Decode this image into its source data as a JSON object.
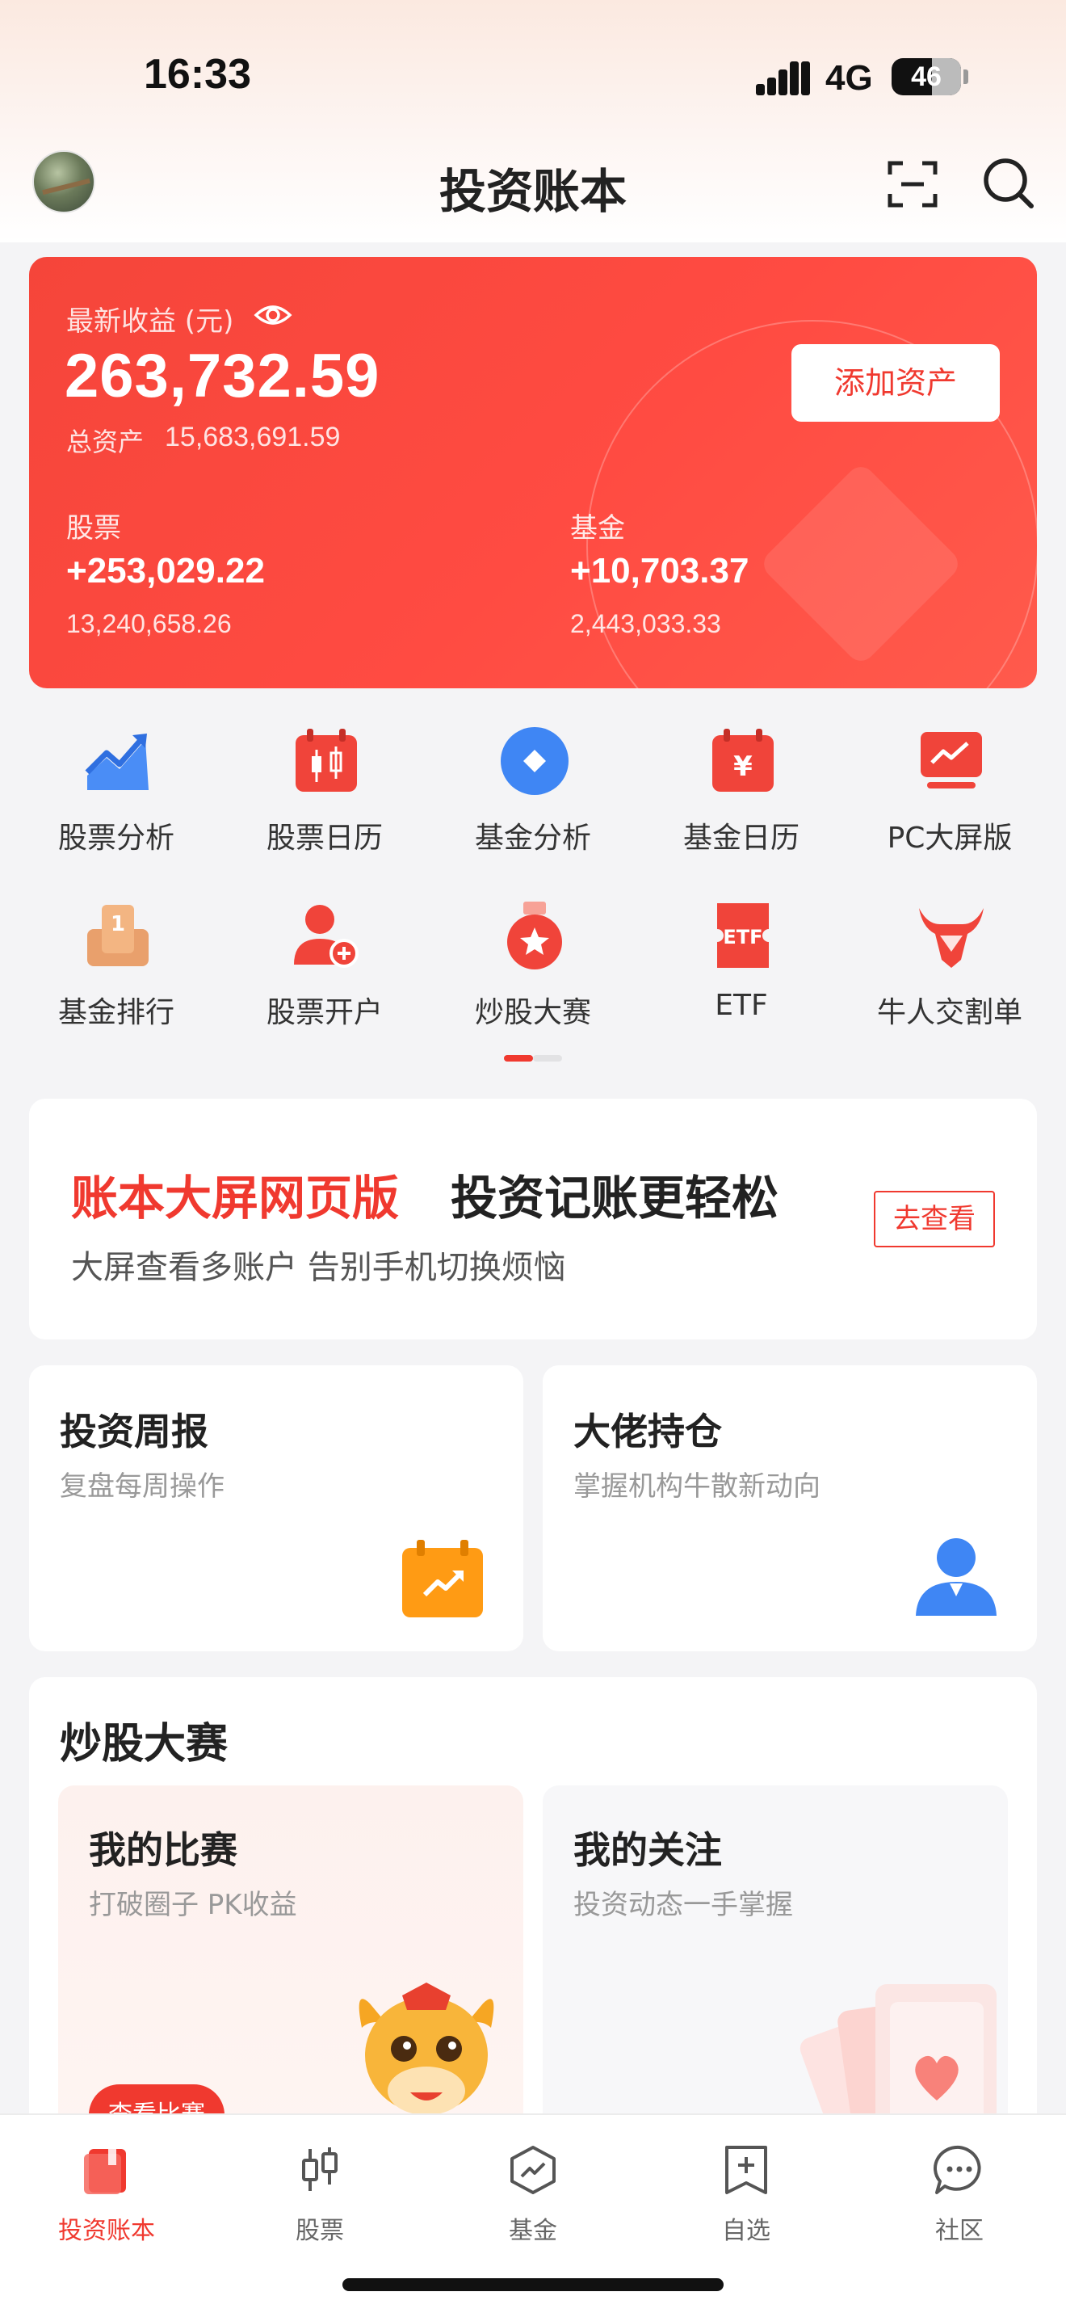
{
  "status_bar": {
    "time": "16:33",
    "network": "4G",
    "battery": "46"
  },
  "nav": {
    "title": "投资账本"
  },
  "summary": {
    "latest_label": "最新收益 (元)",
    "latest_value": "263,732.59",
    "total_label": "总资产",
    "total_value": "15,683,691.59",
    "add_button": "添加资产",
    "stock": {
      "label": "股票",
      "profit": "+253,029.22",
      "total": "13,240,658.26"
    },
    "fund": {
      "label": "基金",
      "profit": "+10,703.37",
      "total": "2,443,033.33"
    }
  },
  "shortcuts": [
    {
      "label": "股票分析",
      "icon": "trend-chart-icon"
    },
    {
      "label": "股票日历",
      "icon": "candlestick-calendar-icon"
    },
    {
      "label": "基金分析",
      "icon": "diamond-circle-icon"
    },
    {
      "label": "基金日历",
      "icon": "yen-calendar-icon"
    },
    {
      "label": "PC大屏版",
      "icon": "monitor-icon"
    },
    {
      "label": "基金排行",
      "icon": "podium-icon"
    },
    {
      "label": "股票开户",
      "icon": "add-user-icon"
    },
    {
      "label": "炒股大赛",
      "icon": "medal-icon"
    },
    {
      "label": "ETF",
      "icon": "etf-ticket-icon"
    },
    {
      "label": "牛人交割单",
      "icon": "bull-icon"
    }
  ],
  "banner": {
    "highlight": "账本大屏网页版",
    "title": "投资记账更轻松",
    "subtitle": "大屏查看多账户 告别手机切换烦恼",
    "button": "去查看"
  },
  "cards": {
    "weekly": {
      "title": "投资周报",
      "subtitle": "复盘每周操作"
    },
    "holdings": {
      "title": "大佬持仓",
      "subtitle": "掌握机构牛散新动向"
    }
  },
  "contest": {
    "heading": "炒股大赛",
    "mine": {
      "title": "我的比赛",
      "subtitle": "打破圈子 PK收益",
      "button": "查看比赛"
    },
    "follow": {
      "title": "我的关注",
      "subtitle": "投资动态一手掌握"
    }
  },
  "tabbar": [
    {
      "label": "投资账本",
      "icon": "book-icon",
      "active": true
    },
    {
      "label": "股票",
      "icon": "candlestick-icon",
      "active": false
    },
    {
      "label": "基金",
      "icon": "fund-hexagon-icon",
      "active": false
    },
    {
      "label": "自选",
      "icon": "add-bookmark-icon",
      "active": false
    },
    {
      "label": "社区",
      "icon": "chat-bubble-icon",
      "active": false
    }
  ],
  "colors": {
    "accent": "#f0392f",
    "card_gradient_start": "#f5453a",
    "card_gradient_end": "#ff5a4c"
  }
}
